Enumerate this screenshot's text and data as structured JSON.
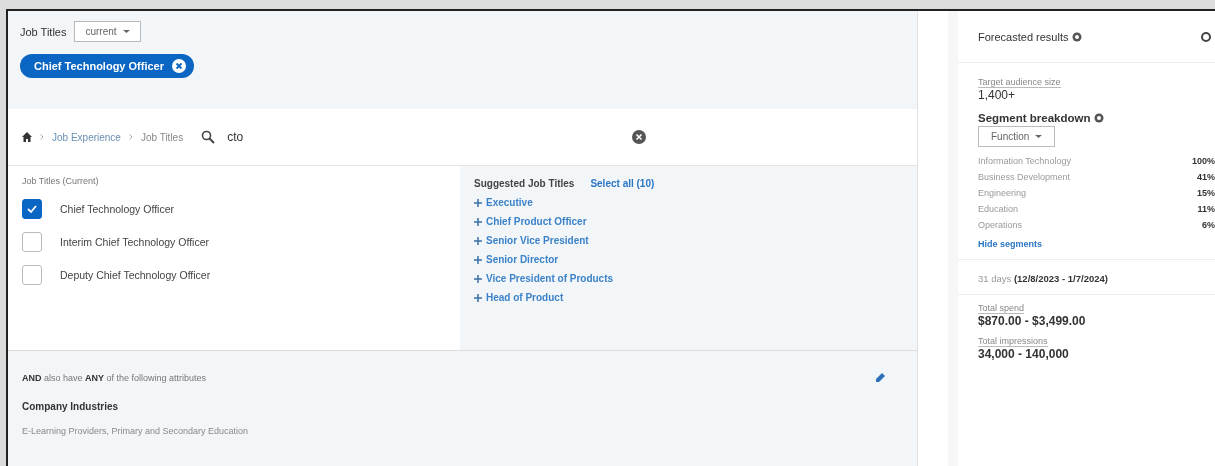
{
  "filter": {
    "label": "Job Titles",
    "dropdown": "current",
    "chips": [
      {
        "label": "Chief Technology Officer"
      }
    ]
  },
  "search": {
    "breadcrumb": [
      "Job Experience",
      "Job Titles"
    ],
    "value": "cto"
  },
  "results": {
    "heading": "Job Titles (Current)",
    "items": [
      {
        "label": "Chief Technology Officer",
        "checked": true
      },
      {
        "label": "Interim Chief Technology Officer",
        "checked": false
      },
      {
        "label": "Deputy Chief Technology Officer",
        "checked": false
      }
    ]
  },
  "suggestions": {
    "heading": "Suggested Job Titles",
    "select_all": "Select all (10)",
    "items": [
      "Executive",
      "Chief Product Officer",
      "Senior Vice President",
      "Senior Director",
      "Vice President of Products",
      "Head of Product"
    ]
  },
  "attributes": {
    "intro": "**AND** also have **ANY** of the following attributes",
    "group": "Company Industries",
    "values": "E-Learning Providers, Primary and Secondary Education"
  },
  "forecast": {
    "title": "Forecasted results",
    "audience_label": "Target audience size",
    "audience": "1,400+",
    "segment_title": "Segment breakdown",
    "segment_dropdown": "Function",
    "segments": [
      {
        "name": "Information Technology",
        "value": "100%"
      },
      {
        "name": "Business Development",
        "value": "41%"
      },
      {
        "name": "Engineering",
        "value": "15%"
      },
      {
        "name": "Education",
        "value": "11%"
      },
      {
        "name": "Operations",
        "value": "6%"
      }
    ],
    "hide_link": "Hide segments",
    "period": "31 days **(12/8/2023 - 1/7/2024)**",
    "metrics": [
      {
        "label": "Total spend",
        "value": "$870.00 - $3,499.00"
      },
      {
        "label": "Total impressions",
        "value": "34,000 - 140,000"
      }
    ]
  }
}
